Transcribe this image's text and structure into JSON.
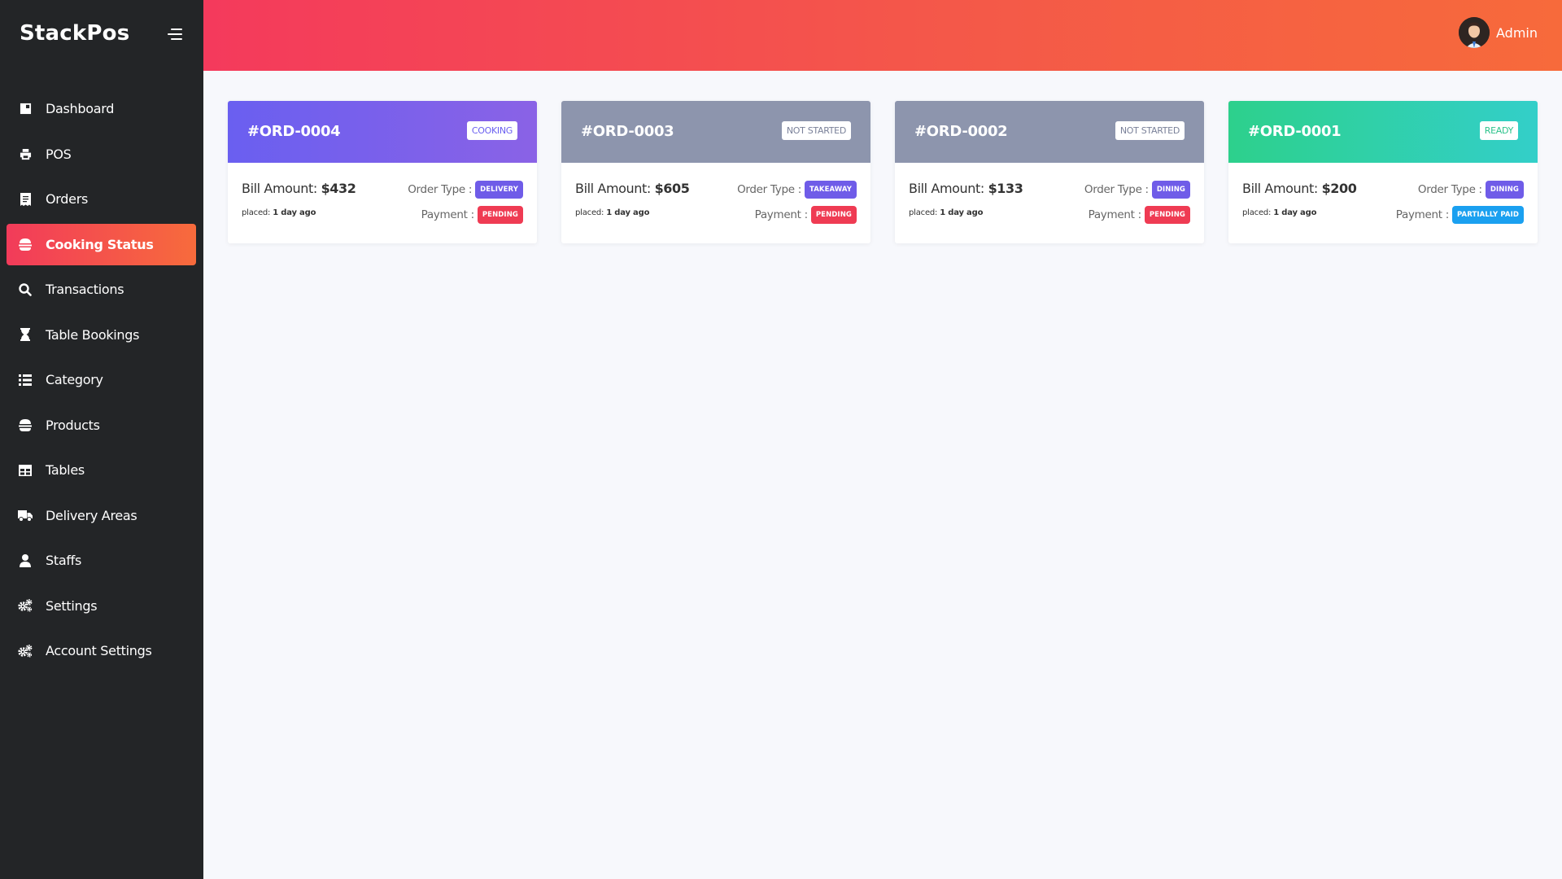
{
  "app": {
    "brand": "StackPos"
  },
  "sidebar": {
    "items": [
      {
        "label": "Dashboard",
        "icon": "dashboard-icon"
      },
      {
        "label": "POS",
        "icon": "printer-icon"
      },
      {
        "label": "Orders",
        "icon": "receipt-icon"
      },
      {
        "label": "Cooking Status",
        "icon": "burger-icon",
        "active": true
      },
      {
        "label": "Transactions",
        "icon": "search-dollar-icon"
      },
      {
        "label": "Table Bookings",
        "icon": "hourglass-icon"
      },
      {
        "label": "Category",
        "icon": "list-icon"
      },
      {
        "label": "Products",
        "icon": "burger-icon"
      },
      {
        "label": "Tables",
        "icon": "table-icon"
      },
      {
        "label": "Delivery Areas",
        "icon": "truck-icon"
      },
      {
        "label": "Staffs",
        "icon": "user-icon"
      },
      {
        "label": "Settings",
        "icon": "gears-icon"
      },
      {
        "label": "Account Settings",
        "icon": "gears-icon"
      }
    ]
  },
  "header": {
    "user_name": "Admin"
  },
  "labels": {
    "bill_amount": "Bill Amount:",
    "placed": "placed:",
    "order_type": "Order Type :",
    "payment": "Payment :"
  },
  "orders": [
    {
      "id": "#ORD-0004",
      "status": "COOKING",
      "amount": "$432",
      "placed_ago": "1 day ago",
      "order_type": "DELIVERY",
      "payment": "PENDING"
    },
    {
      "id": "#ORD-0003",
      "status": "NOT STARTED",
      "amount": "$605",
      "placed_ago": "1 day ago",
      "order_type": "TAKEAWAY",
      "payment": "PENDING"
    },
    {
      "id": "#ORD-0002",
      "status": "NOT STARTED",
      "amount": "$133",
      "placed_ago": "1 day ago",
      "order_type": "DINING",
      "payment": "PENDING"
    },
    {
      "id": "#ORD-0001",
      "status": "READY",
      "amount": "$200",
      "placed_ago": "1 day ago",
      "order_type": "DINING",
      "payment": "PARTIALLY PAID"
    }
  ],
  "colors": {
    "sidebar_bg": "#232527",
    "accent_start": "#f23b5a",
    "accent_end": "#f76b3c",
    "cooking_start": "#6a5ff0",
    "cooking_end": "#8a62e6",
    "not_started": "#8d95ad",
    "ready_start": "#2dd08c",
    "ready_end": "#33cfc9",
    "pill_purple": "#6f5ce8",
    "pill_red": "#ef3b53",
    "pill_blue": "#1aa0f0"
  }
}
